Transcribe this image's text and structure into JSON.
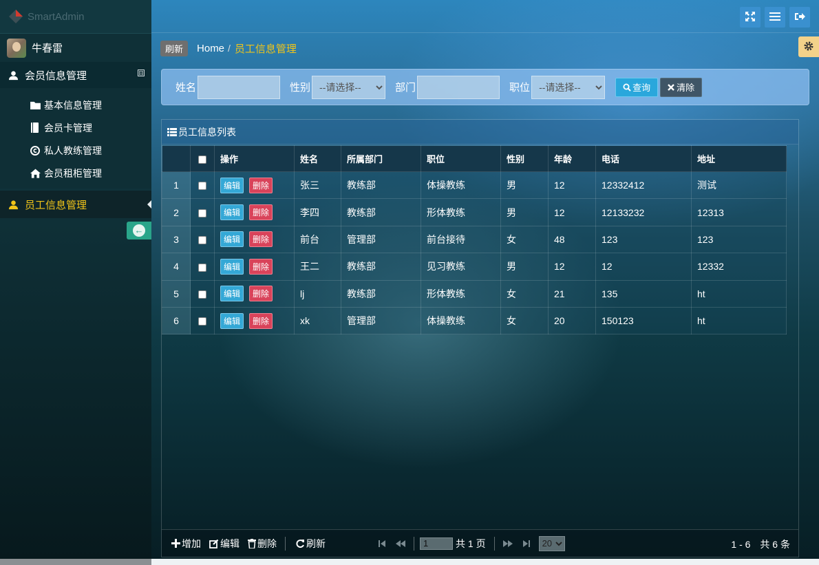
{
  "brand": {
    "name": "SmartAdmin"
  },
  "user": {
    "name": "牛春雷"
  },
  "sidebar": {
    "group_label": "会员信息管理",
    "group_toggle": "⊟",
    "items": [
      {
        "label": "基本信息管理",
        "icon": "folder-icon"
      },
      {
        "label": "会员卡管理",
        "icon": "book-icon"
      },
      {
        "label": "私人教练管理",
        "icon": "copyright-icon"
      },
      {
        "label": "会员租柜管理",
        "icon": "home-icon"
      }
    ],
    "active_label": "员工信息管理"
  },
  "breadcrumb": {
    "refresh": "刷新",
    "home": "Home",
    "sep": "/",
    "current": "员工信息管理"
  },
  "search": {
    "name_label": "姓名",
    "gender_label": "性别",
    "gender_placeholder": "--请选择--",
    "dept_label": "部门",
    "position_label": "职位",
    "position_placeholder": "--请选择--",
    "query_button": "查询",
    "clear_button": "清除"
  },
  "grid": {
    "title": "员工信息列表",
    "columns": [
      "操作",
      "姓名",
      "所属部门",
      "职位",
      "性别",
      "年龄",
      "电话",
      "地址"
    ],
    "edit_label": "编辑",
    "delete_label": "删除",
    "rows": [
      {
        "num": "1",
        "name": "张三",
        "dept": "教练部",
        "position": "体操教练",
        "gender": "男",
        "age": "12",
        "phone": "12332412",
        "address": "测试"
      },
      {
        "num": "2",
        "name": "李四",
        "dept": "教练部",
        "position": "形体教练",
        "gender": "男",
        "age": "12",
        "phone": "12133232",
        "address": "12313"
      },
      {
        "num": "3",
        "name": "前台",
        "dept": "管理部",
        "position": "前台接待",
        "gender": "女",
        "age": "48",
        "phone": "123",
        "address": "123"
      },
      {
        "num": "4",
        "name": "王二",
        "dept": "教练部",
        "position": "见习教练",
        "gender": "男",
        "age": "12",
        "phone": "12",
        "address": "12332"
      },
      {
        "num": "5",
        "name": "lj",
        "dept": "教练部",
        "position": "形体教练",
        "gender": "女",
        "age": "21",
        "phone": "135",
        "address": "ht"
      },
      {
        "num": "6",
        "name": "xk",
        "dept": "管理部",
        "position": "体操教练",
        "gender": "女",
        "age": "20",
        "phone": "150123",
        "address": "ht"
      }
    ]
  },
  "pager": {
    "add": "增加",
    "edit": "编辑",
    "delete": "删除",
    "refresh": "刷新",
    "page_value": "1",
    "page_total": "共 1 页",
    "page_size": "20",
    "summary": "1 - 6　共 6 条"
  },
  "colors": {
    "accent_yellow": "#f0c419",
    "edit_blue": "#34a8d6",
    "delete_red": "#d9435a"
  }
}
